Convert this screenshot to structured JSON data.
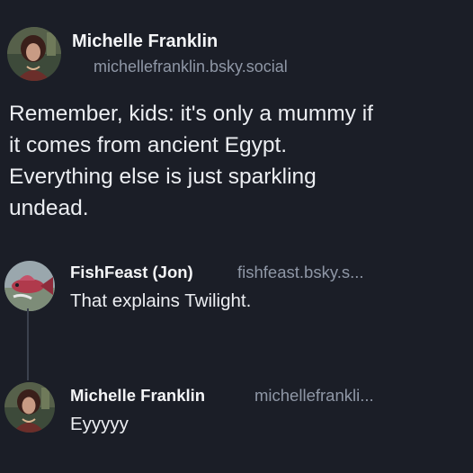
{
  "colors": {
    "background": "#1b1e27",
    "name_text": "#f4f5f7",
    "handle_text": "#8f97a6",
    "body_text": "#eceef2",
    "thread_line": "#3b414d"
  },
  "main_post": {
    "author_name": "Michelle Franklin",
    "author_handle": "michellefranklin.bsky.social",
    "avatar": "michelle-franklin-avatar",
    "text": "Remember, kids: it's only a mummy if\nit comes from ancient Egypt.\nEverything else is just sparkling\nundead."
  },
  "replies": [
    {
      "author_name": "FishFeast (Jon)",
      "author_handle": "fishfeast.bsky.s...",
      "avatar": "fish-avatar",
      "text": "That explains Twilight."
    },
    {
      "author_name": "Michelle Franklin",
      "author_handle": "michellefrankli...",
      "avatar": "michelle-franklin-avatar",
      "text": "Eyyyyy"
    }
  ]
}
